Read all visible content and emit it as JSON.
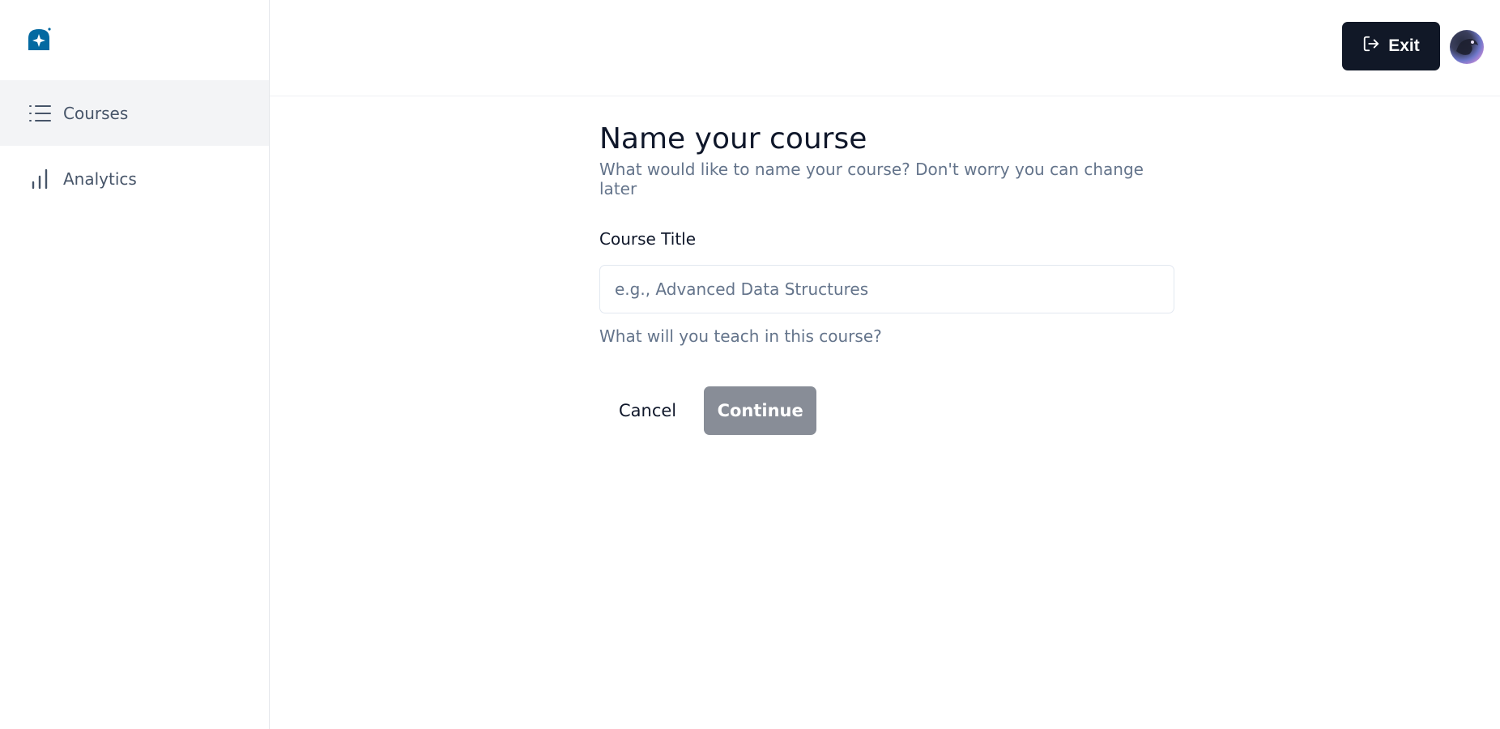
{
  "brand": {
    "logo_icon": "logo-icon",
    "color": "#0369a1"
  },
  "sidebar": {
    "items": [
      {
        "label": "Courses",
        "icon": "list-icon",
        "active": true
      },
      {
        "label": "Analytics",
        "icon": "bar-chart-icon",
        "active": false
      }
    ]
  },
  "header": {
    "exit_label": "Exit",
    "exit_icon": "log-out-icon",
    "avatar_icon": "avatar"
  },
  "form": {
    "title": "Name your course",
    "subtitle": "What would like to name your course? Don't worry you can change later",
    "field_label": "Course Title",
    "input_value": "",
    "input_placeholder": "e.g., Advanced Data Structures",
    "hint": "What will you teach in this course?",
    "cancel_label": "Cancel",
    "continue_label": "Continue"
  },
  "colors": {
    "primary_dark": "#111827",
    "disabled_button": "#888d97",
    "muted_text": "#64748b",
    "active_nav_bg": "#f3f4f6"
  }
}
